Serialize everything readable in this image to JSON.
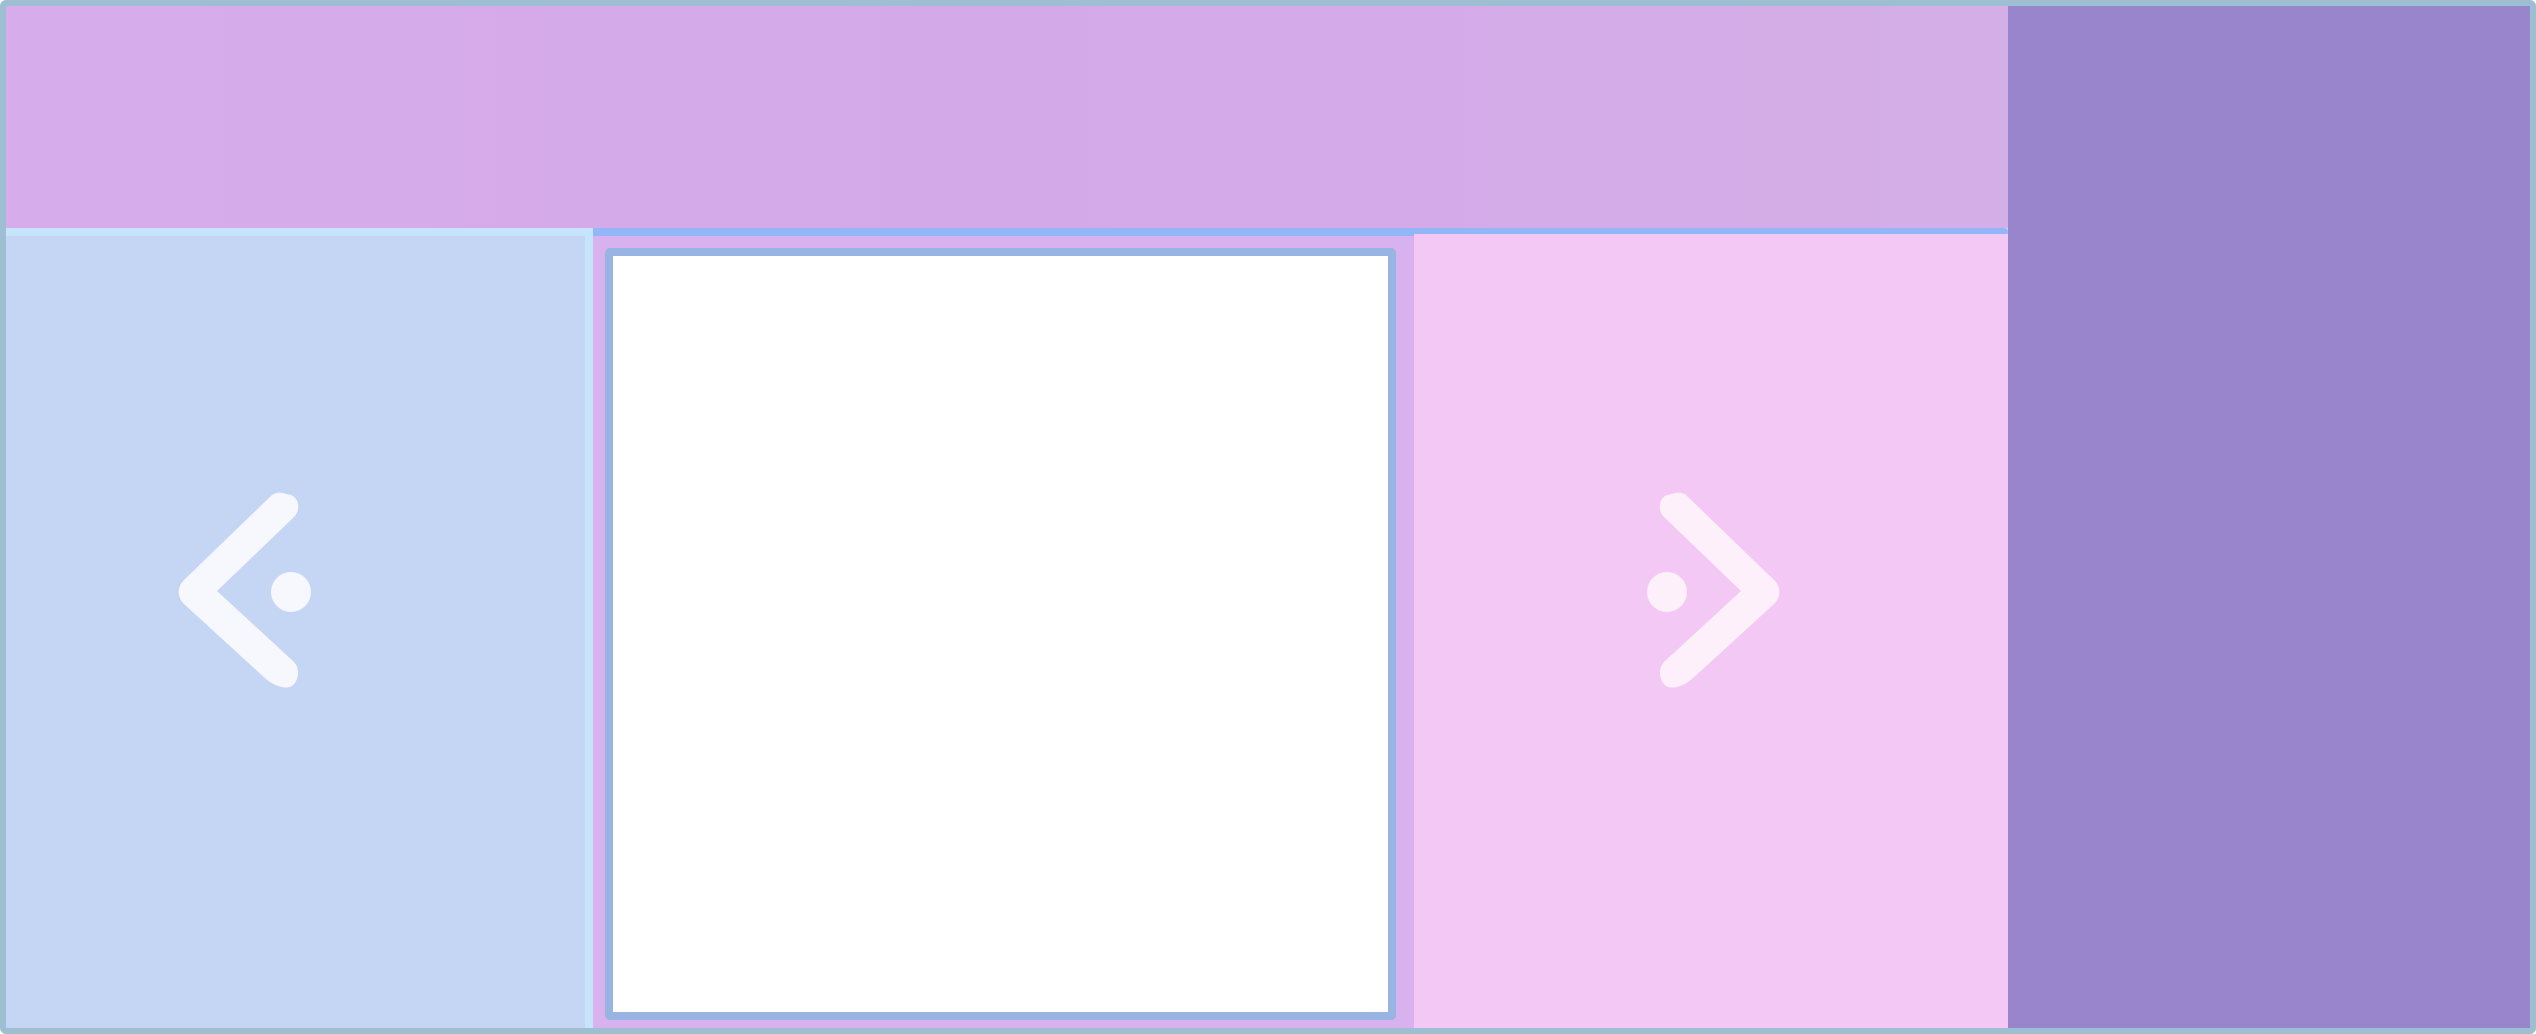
{
  "carousel": {
    "prev_icon": "chevron-left-icon",
    "next_icon": "chevron-right-icon",
    "slide_content": ""
  },
  "colors": {
    "frame_border": "#9dbfd1",
    "top_band": "#d5abe8",
    "right_panel": "#9885cb",
    "left_panel": "#c4d6f3",
    "left_panel_edge": "#c6e4fb",
    "center_panel": "#d8b2ee",
    "center_top_line": "#93b6f8",
    "viewport_border": "#97b4e3",
    "viewport_fill": "#ffffff",
    "pink_panel": "#f4c8f4",
    "icon_fill": "#f7f8fd"
  }
}
